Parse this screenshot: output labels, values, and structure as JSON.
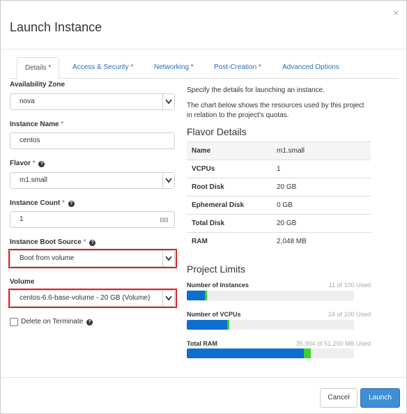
{
  "dialog": {
    "title": "Launch Instance",
    "close_glyph": "×"
  },
  "tabs": [
    {
      "label": "Details *",
      "active": true
    },
    {
      "label": "Access & Security *",
      "active": false
    },
    {
      "label": "Networking *",
      "active": false
    },
    {
      "label": "Post-Creation *",
      "active": false
    },
    {
      "label": "Advanced Options",
      "active": false
    }
  ],
  "form": {
    "availability_zone": {
      "label": "Availability Zone",
      "value": "nova"
    },
    "instance_name": {
      "label": "Instance Name",
      "required": "*",
      "value": "centos"
    },
    "flavor": {
      "label": "Flavor",
      "required": "*",
      "help": "?",
      "value": "m1.small"
    },
    "instance_count": {
      "label": "Instance Count",
      "required": "*",
      "help": "?",
      "value": "1"
    },
    "boot_source": {
      "label": "Instance Boot Source",
      "required": "*",
      "help": "?",
      "value": "Boot from volume"
    },
    "volume": {
      "label": "Volume",
      "value": "centos-6.6-base-volume - 20 GB (Volume)"
    },
    "delete_on_terminate": {
      "label": "Delete on Terminate",
      "help": "?",
      "checked": false
    }
  },
  "info": {
    "intro": "Specify the details for launching an instance.",
    "chart_note": "The chart below shows the resources used by this project in relation to the project's quotas."
  },
  "flavor_details": {
    "heading": "Flavor Details",
    "rows": [
      {
        "key": "Name",
        "value": "m1.small"
      },
      {
        "key": "VCPUs",
        "value": "1"
      },
      {
        "key": "Root Disk",
        "value": "20 GB"
      },
      {
        "key": "Ephemeral Disk",
        "value": "0 GB"
      },
      {
        "key": "Total Disk",
        "value": "20 GB"
      },
      {
        "key": "RAM",
        "value": "2,048 MB"
      }
    ]
  },
  "project_limits": {
    "heading": "Project Limits",
    "items": [
      {
        "label": "Number of Instances",
        "used_text": "11 of 100 Used",
        "used": 11,
        "total": 100,
        "adding": 1
      },
      {
        "label": "Number of VCPUs",
        "used_text": "24 of 100 Used",
        "used": 24,
        "total": 100,
        "adding": 1
      },
      {
        "label": "Total RAM",
        "used_text": "35,904 of 51,200 MB Used",
        "used": 35904,
        "total": 51200,
        "adding": 2048
      }
    ],
    "colors": {
      "used": "#0e6fce",
      "adding": "#3cd12c",
      "track": "#eeeeee"
    }
  },
  "footer": {
    "cancel_label": "Cancel",
    "launch_label": "Launch"
  }
}
